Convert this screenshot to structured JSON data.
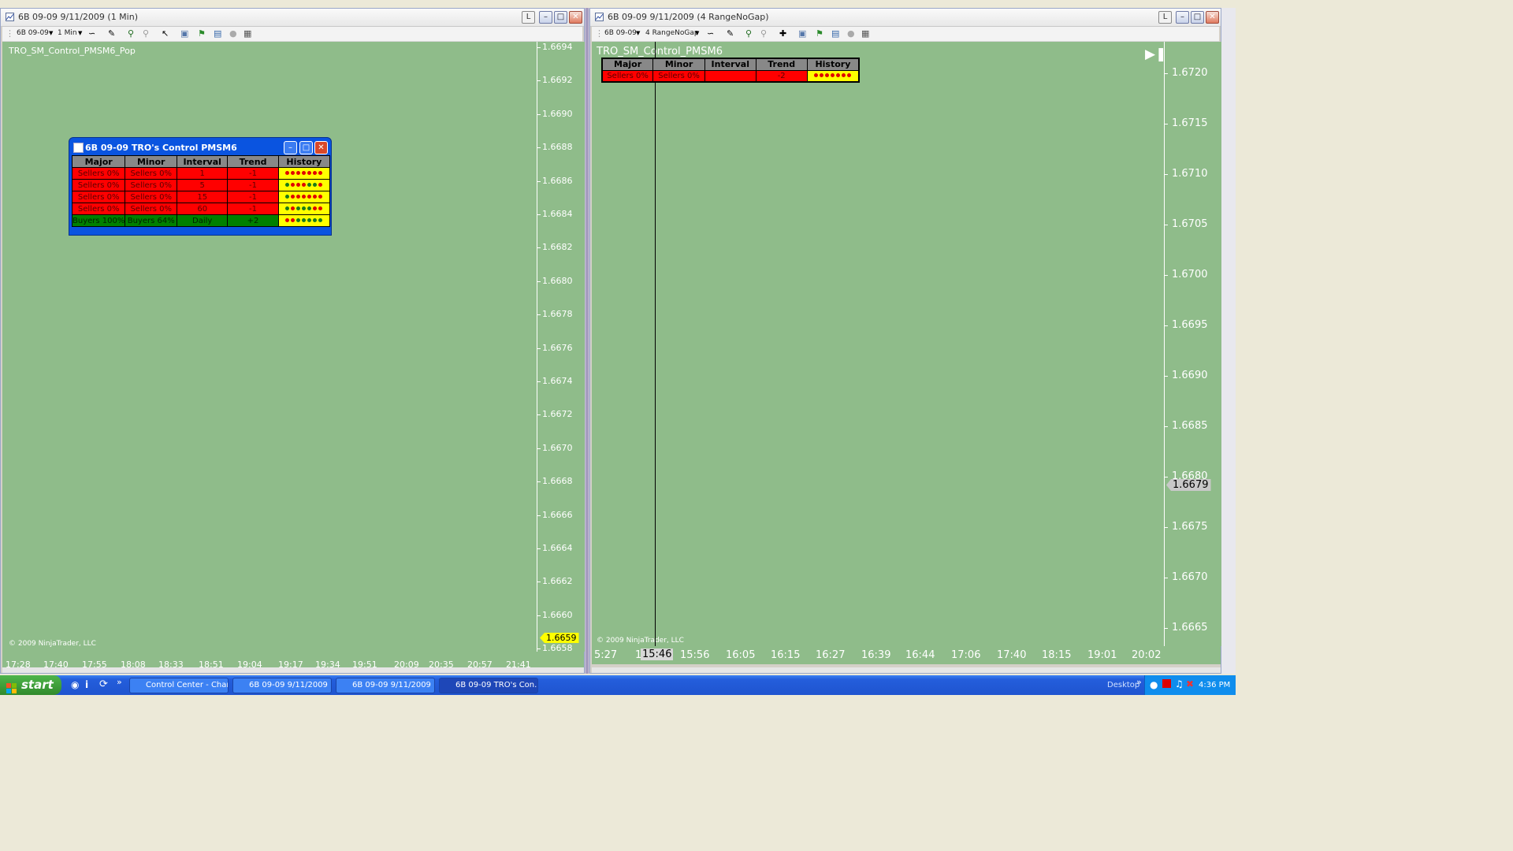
{
  "left_window": {
    "title": "6B 09-09  9/11/2009 (1 Min)",
    "toolbar": {
      "instrument": "6B 09-09",
      "interval": "1 Min"
    },
    "indicator_label": "TRO_SM_Control_PMSM6_Pop",
    "copyright": "© 2009 NinjaTrader, LLC",
    "price_labels": [
      "1.6694",
      "1.6692",
      "1.6690",
      "1.6688",
      "1.6686",
      "1.6684",
      "1.6682",
      "1.6680",
      "1.6678",
      "1.6676",
      "1.6674",
      "1.6672",
      "1.6670",
      "1.6668",
      "1.6666",
      "1.6664",
      "1.6662",
      "1.6660",
      "1.6658"
    ],
    "current_price": "1.6659",
    "current_price_color": "#ffff00",
    "time_labels": [
      "17:28",
      "17:40",
      "17:55",
      "18:08",
      "18:33",
      "18:51",
      "19:04",
      "19:17",
      "19:34",
      "19:51",
      "20:09",
      "20:35",
      "20:57",
      "21:41"
    ],
    "background_color": "#8fbc8a"
  },
  "popup": {
    "title": "6B 09-09   TRO's Control PMSM6",
    "headers": [
      "Major",
      "Minor",
      "Interval",
      "Trend",
      "History"
    ],
    "rows": [
      {
        "major": "Sellers 0%",
        "minor": "Sellers 0%",
        "interval": "1",
        "trend": "-1",
        "color": "red",
        "history": [
          "r",
          "r",
          "r",
          "r",
          "r",
          "r",
          "r"
        ]
      },
      {
        "major": "Sellers 0%",
        "minor": "Sellers 0%",
        "interval": "5",
        "trend": "-1",
        "color": "red",
        "history": [
          "g",
          "r",
          "r",
          "r",
          "g",
          "g",
          "r"
        ]
      },
      {
        "major": "Sellers 0%",
        "minor": "Sellers 0%",
        "interval": "15",
        "trend": "-1",
        "color": "red",
        "history": [
          "g",
          "r",
          "r",
          "r",
          "r",
          "r",
          "r"
        ]
      },
      {
        "major": "Sellers 0%",
        "minor": "Sellers 0%",
        "interval": "60",
        "trend": "-1",
        "color": "red",
        "history": [
          "g",
          "r",
          "g",
          "g",
          "g",
          "r",
          "r"
        ]
      },
      {
        "major": "Buyers 100%",
        "minor": "Buyers 64%",
        "interval": "Daily",
        "trend": "+2",
        "color": "grn",
        "history": [
          "r",
          "r",
          "g",
          "g",
          "g",
          "g",
          "g"
        ]
      }
    ]
  },
  "right_window": {
    "title": "6B 09-09  9/11/2009 (4 RangeNoGap)",
    "toolbar": {
      "instrument": "6B 09-09",
      "interval": "4 RangeNoGap"
    },
    "indicator_label": "TRO_SM_Control_PMSM6",
    "copyright": "© 2009 NinjaTrader, LLC",
    "table": {
      "headers": [
        "Major",
        "Minor",
        "Interval",
        "Trend",
        "History"
      ],
      "row": {
        "major": "Sellers 0%",
        "minor": "Sellers 0%",
        "interval": "",
        "trend": "-2",
        "history": [
          "r",
          "r",
          "r",
          "r",
          "r",
          "r",
          "r"
        ]
      }
    },
    "price_labels": [
      "1.6720",
      "1.6715",
      "1.6710",
      "1.6705",
      "1.6700",
      "1.6695",
      "1.6690",
      "1.6685",
      "1.6680",
      "1.6675",
      "1.6670",
      "1.6665"
    ],
    "current_price": "1.6679",
    "time_labels": [
      "5:27",
      "1",
      "15:56",
      "16:05",
      "16:15",
      "16:27",
      "16:39",
      "16:44",
      "17:06",
      "17:40",
      "18:15",
      "19:01",
      "20:02"
    ],
    "crosshair_time": "15:46",
    "background_color": "#8fbc8a"
  },
  "taskbar": {
    "start_label": "start",
    "buttons": [
      "Control Center - Char...",
      "6B 09-09  9/11/2009 ...",
      "6B 09-09  9/11/2009 ...",
      "6B 09-09   TRO's Con..."
    ],
    "desktop_label": "Desktop",
    "clock": "4:36 PM"
  }
}
